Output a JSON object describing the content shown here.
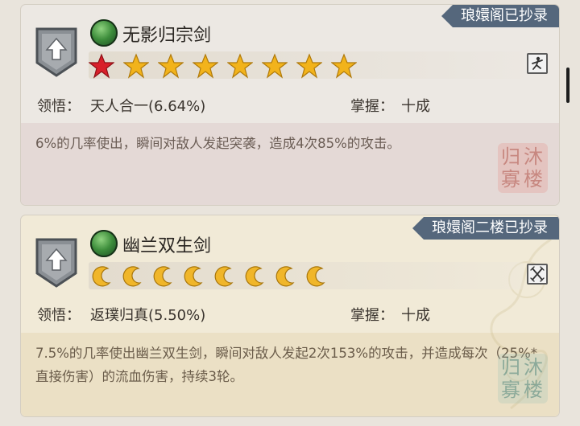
{
  "cards": [
    {
      "ribbon": "琅嬛阁已抄录",
      "skill_name": "无影归宗剑",
      "insight_label": "领悟：",
      "insight_value": "天人合一(6.64%)",
      "mastery_label": "掌握：",
      "mastery_value": "十成",
      "description": "6%的几率使出，瞬间对敌人发起突袭，造成4次85%的攻击。",
      "rating": {
        "type": "star",
        "filled_red": 1,
        "total": 8
      },
      "seal": "归沐寡楼"
    },
    {
      "ribbon": "琅嬛阁二楼已抄录",
      "skill_name": "幽兰双生剑",
      "insight_label": "领悟：",
      "insight_value": "返璞归真(5.50%)",
      "mastery_label": "掌握：",
      "mastery_value": "十成",
      "description": "7.5%的几率使出幽兰双生剑，瞬间对敌人发起2次153%的攻击，并造成每次（25%*直接伤害）的流血伤害，持续3轮。",
      "rating": {
        "type": "moon",
        "total": 8
      },
      "seal": "归沐寡楼"
    }
  ],
  "colors": {
    "ribbon": "#55677c",
    "star_gold": "#f2b31b",
    "star_red": "#d8202a",
    "moon_gold": "#f0b62a"
  }
}
